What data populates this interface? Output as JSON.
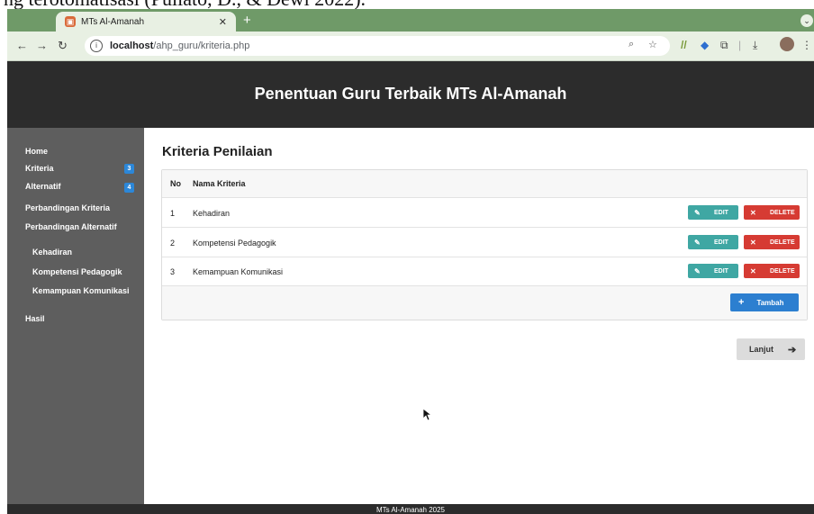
{
  "doc_text": "ng terotomatisasi (Puliato, D., & Dewi 2022).",
  "browser": {
    "tab_title": "MTs Al-Amanah",
    "url_host": "localhost",
    "url_path": "/ahp_guru/kriteria.php"
  },
  "site": {
    "title": "Penentuan Guru Terbaik MTs Al-Amanah",
    "footer": "MTs Al-Amanah 2025"
  },
  "sidebar": {
    "items": [
      {
        "label": "Home"
      },
      {
        "label": "Kriteria",
        "badge": "3"
      },
      {
        "label": "Alternatif",
        "badge": "4"
      },
      {
        "label": "Perbandingan Kriteria"
      },
      {
        "label": "Perbandingan Alternatif"
      },
      {
        "label": "Kehadiran"
      },
      {
        "label": "Kompetensi Pedagogik"
      },
      {
        "label": "Kemampuan Komunikasi"
      },
      {
        "label": "Hasil"
      }
    ]
  },
  "main": {
    "title": "Kriteria Penilaian",
    "columns": [
      "No",
      "Nama Kriteria"
    ],
    "rows": [
      {
        "no": "1",
        "name": "Kehadiran"
      },
      {
        "no": "2",
        "name": "Kompetensi Pedagogik"
      },
      {
        "no": "3",
        "name": "Kemampuan Komunikasi"
      }
    ],
    "edit_label": "EDIT",
    "delete_label": "DELETE",
    "add_label": "Tambah",
    "next_label": "Lanjut"
  },
  "colors": {
    "header_bg": "#2c2c2c",
    "sidebar_bg": "#5e5e5e",
    "edit_btn": "#3fa7a3",
    "delete_btn": "#d63b33",
    "add_btn": "#2c7fd0",
    "badge": "#2c87d8",
    "tabbar": "#6f9a68"
  },
  "icons": {
    "edit": "pencil-icon",
    "delete": "x-icon",
    "add": "plus-icon",
    "next": "arrow-right-icon"
  }
}
